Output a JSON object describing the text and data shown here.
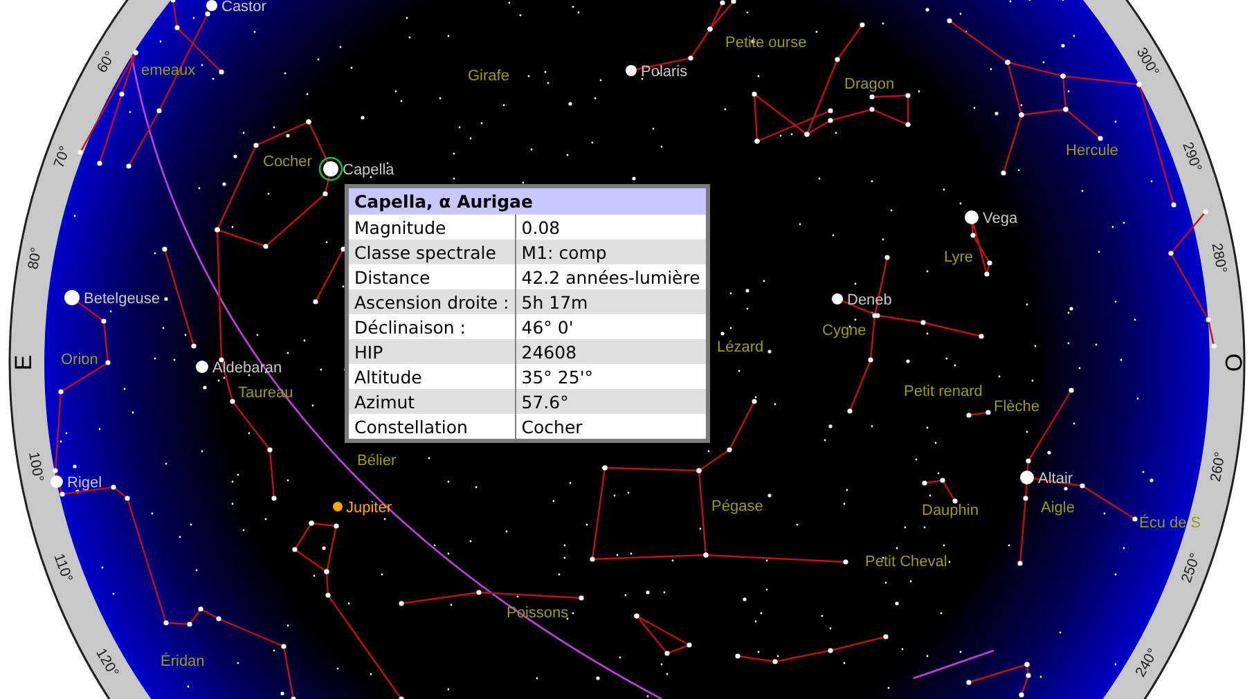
{
  "compass_labels": [
    "E",
    "O"
  ],
  "azimuth_ticks": [
    "60°",
    "70°",
    "80°",
    "100°",
    "110°",
    "120°",
    "300°",
    "290°",
    "280°",
    "260°",
    "250°",
    "240°"
  ],
  "stars": [
    {
      "name": "Castor",
      "selected": false
    },
    {
      "name": "Polaris",
      "selected": false
    },
    {
      "name": "Capella",
      "selected": true
    },
    {
      "name": "Vega",
      "selected": false
    },
    {
      "name": "Betelgeuse",
      "selected": false
    },
    {
      "name": "Deneb",
      "selected": false
    },
    {
      "name": "Aldebaran",
      "selected": false
    },
    {
      "name": "Altair",
      "selected": false
    },
    {
      "name": "Rigel",
      "selected": false
    }
  ],
  "planets": [
    {
      "name": "Jupiter"
    }
  ],
  "constellations": [
    "emeaux",
    "Petite ourse",
    "Girafe",
    "Dragon",
    "Cocher",
    "Hercule",
    "Lyre",
    "Cygne",
    "Orion",
    "Lézard",
    "Taureau",
    "Petit renard",
    "Flèche",
    "Bélier",
    "Pégase",
    "Dauphin",
    "Aigle",
    "Écu de S",
    "Petit Cheval",
    "Poissons",
    "Éridan"
  ],
  "info_popup": {
    "title": "Capella, α Aurigae",
    "rows": [
      {
        "label": "Magnitude",
        "value": "0.08"
      },
      {
        "label": "Classe spectrale",
        "value": "M1: comp"
      },
      {
        "label": "Distance",
        "value": "42.2 années-lumière"
      },
      {
        "label": "Ascension droite :",
        "value": "5h 17m"
      },
      {
        "label": "Déclinaison :",
        "value": "46° 0'"
      },
      {
        "label": "HIP",
        "value": "24608"
      },
      {
        "label": "Altitude",
        "value": "35° 25'°"
      },
      {
        "label": "Azimut",
        "value": "57.6°"
      },
      {
        "label": "Constellation",
        "value": "Cocher"
      }
    ]
  }
}
